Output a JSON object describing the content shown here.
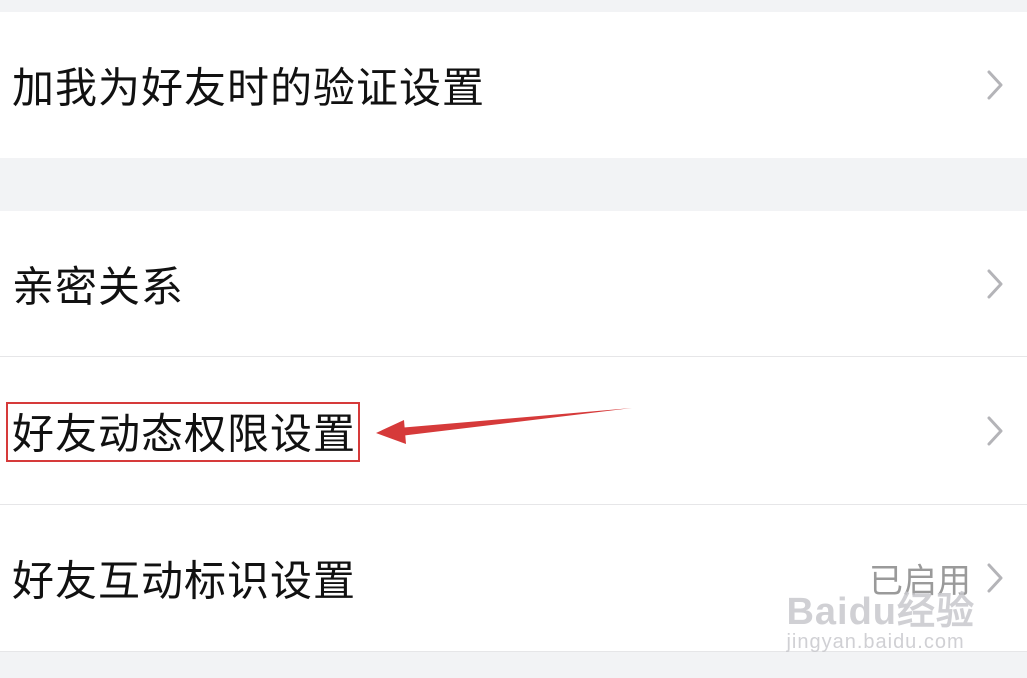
{
  "settings": {
    "rows": [
      {
        "label": "加我为好友时的验证设置",
        "value": ""
      },
      {
        "label": "亲密关系",
        "value": ""
      },
      {
        "label": "好友动态权限设置",
        "value": ""
      },
      {
        "label": "好友互动标识设置",
        "value": "已启用"
      }
    ]
  },
  "annotation": {
    "color": "#d63a3a"
  },
  "watermark": {
    "main": "Baidu经验",
    "sub": "jingyan.baidu.com"
  },
  "icons": {
    "chevron": "chevron-right-icon"
  }
}
